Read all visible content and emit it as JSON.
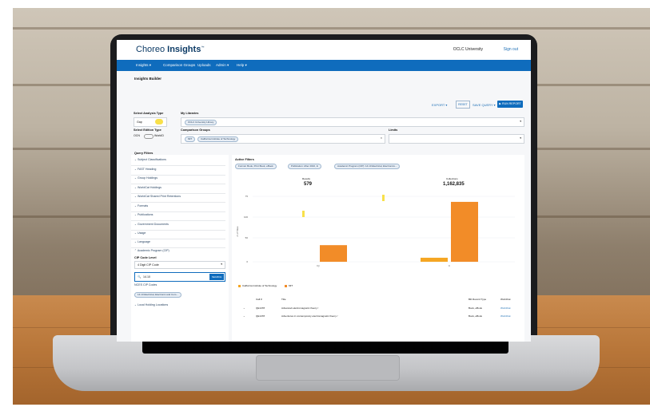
{
  "app": {
    "brand_light": "Choreo ",
    "brand_bold": "Insights",
    "tm": "™",
    "institution": "OCLC University",
    "signout": "Sign out",
    "nav": [
      "Insights ▾",
      "Comparison Groups",
      "Uploads",
      "Admin ▾",
      "Help ▾"
    ],
    "breadcrumb": "Insights Builder"
  },
  "toolbar": {
    "export": "EXPORT ▾",
    "reset": "RESET",
    "save": "SAVE QUERY ▾",
    "run": "▶ RUN REPORT"
  },
  "analysis": {
    "type_label": "Select Analysis Type",
    "type_value": "Gap",
    "edition_label": "Select Edition Type",
    "edition_left": "OCN",
    "edition_right": "WorkID",
    "libraries_label": "My Libraries",
    "libraries_chip": "OCLC University Library",
    "comparison_label": "Comparison Groups",
    "comparison_chips": [
      "MIT",
      "California Institute of Technology"
    ],
    "limits_label": "Limits"
  },
  "filters": {
    "heading": "Query Filters",
    "items": [
      "Subject Classifications",
      "FAST Heading",
      "Group Holdings",
      "WorldCat Holdings",
      "WorldCat Shared Print Retentions",
      "Formats",
      "Publications",
      "Government Documents",
      "Usage",
      "Language",
      "Academic Program (CIP)"
    ],
    "cip_level_label": "CIP Code Level",
    "cip_level_value": "4 Digit CIP Code",
    "search_value": "14.10",
    "search_button": "SEARCH",
    "note": "NCES CIP Codes",
    "selected_chip": "14.10 Electrical, Electronic and Com...",
    "more": "Local Holding Locations"
  },
  "active_filters": {
    "heading": "Active Filters",
    "chips": [
      "Format: Book, Print Book, eBook",
      "Publication: After 2010, In",
      "Academic Program (CIP): 14.10 Electrical, Electronics..."
    ]
  },
  "stats": {
    "a_label": "Results",
    "a_value": "579",
    "b_label": "Collections",
    "b_value": "1,162,835"
  },
  "chart_data": {
    "type": "bar",
    "categories": [
      "IQ",
      "C"
    ],
    "series": [
      {
        "name": "California Institute of Technology",
        "values": [
          0,
          8
        ]
      },
      {
        "name": "MIT",
        "values": [
          33,
          119
        ]
      }
    ],
    "yticks": [
      "75",
      "100",
      "50",
      "0"
    ],
    "ylabel": "# of Titles",
    "ylim": [
      0,
      130
    ],
    "colors": {
      "california": "#f5a623",
      "mit": "#f28c28",
      "highlight": "#f8e04a"
    }
  },
  "table": {
    "headers": [
      "Call #",
      "Title",
      "Bib Record Type",
      "WorldCat"
    ],
    "rows": [
      [
        "QE1478",
        "Advanced electromagnetic theory /",
        "Book, eBook",
        "WorldCat"
      ],
      [
        "QE1478",
        "Adventures in contemporary electromagnetic theory /",
        "Book, eBook",
        "WorldCat"
      ]
    ]
  }
}
